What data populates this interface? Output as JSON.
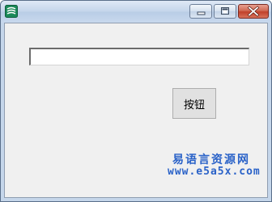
{
  "window": {
    "icon": "app-logo-icon",
    "controls": {
      "minimize_icon": "minimize-icon",
      "maximize_icon": "maximize-icon",
      "close_icon": "close-icon"
    }
  },
  "form": {
    "textbox_value": "",
    "button_label": "按钮"
  },
  "watermark": {
    "site_name": "易语言资源网",
    "url": "www.e5a5x.com"
  },
  "colors": {
    "titlebar": "#c4d5ea",
    "client_bg": "#f0f0f0",
    "close_button": "#c0402a",
    "watermark": "#2a62c8"
  }
}
